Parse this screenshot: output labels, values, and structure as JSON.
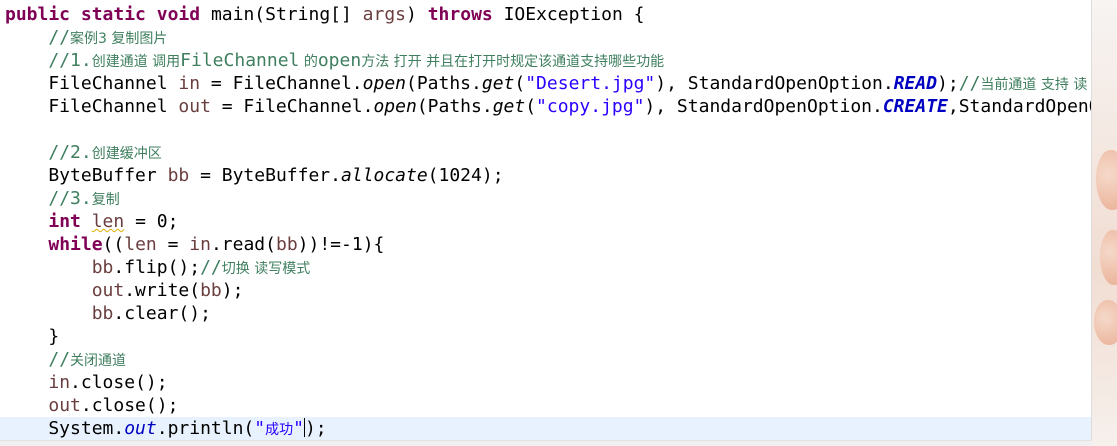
{
  "editor": {
    "language": "Java",
    "lines": [
      [
        {
          "t": "public",
          "c": "kw"
        },
        {
          "t": " "
        },
        {
          "t": "static",
          "c": "kw"
        },
        {
          "t": " "
        },
        {
          "t": "void",
          "c": "kw"
        },
        {
          "t": " main(String[] "
        },
        {
          "t": "args",
          "c": "var"
        },
        {
          "t": ") "
        },
        {
          "t": "throws",
          "c": "kw"
        },
        {
          "t": " IOException {"
        }
      ],
      [
        {
          "t": "    "
        },
        {
          "t": "//",
          "c": "cm"
        },
        {
          "t": "案例3 复制图片",
          "c": "cm cjk"
        }
      ],
      [
        {
          "t": "    "
        },
        {
          "t": "//1.",
          "c": "cm"
        },
        {
          "t": "创建通道 调用",
          "c": "cm cjk"
        },
        {
          "t": "FileChannel",
          "c": "cm"
        },
        {
          "t": " 的",
          "c": "cm cjk"
        },
        {
          "t": "open",
          "c": "cm"
        },
        {
          "t": "方法 打开 并且在打开时规定该通道支持哪些功能",
          "c": "cm cjk"
        }
      ],
      [
        {
          "t": "    FileChannel "
        },
        {
          "t": "in",
          "c": "var"
        },
        {
          "t": " = FileChannel."
        },
        {
          "t": "open",
          "c": "meth"
        },
        {
          "t": "(Paths."
        },
        {
          "t": "get",
          "c": "meth"
        },
        {
          "t": "("
        },
        {
          "t": "\"Desert.jpg\"",
          "c": "str"
        },
        {
          "t": "), StandardOpenOption."
        },
        {
          "t": "READ",
          "c": "const"
        },
        {
          "t": ");"
        },
        {
          "t": "//",
          "c": "cm"
        },
        {
          "t": "当前通道 支持 读",
          "c": "cm cjk"
        }
      ],
      [
        {
          "t": "    FileChannel "
        },
        {
          "t": "out",
          "c": "var"
        },
        {
          "t": " = FileChannel."
        },
        {
          "t": "open",
          "c": "meth"
        },
        {
          "t": "(Paths."
        },
        {
          "t": "get",
          "c": "meth"
        },
        {
          "t": "("
        },
        {
          "t": "\"copy.jpg\"",
          "c": "str"
        },
        {
          "t": "), StandardOpenOption."
        },
        {
          "t": "CREATE",
          "c": "const"
        },
        {
          "t": ",StandardOpenOption"
        }
      ],
      [
        {
          "t": ""
        }
      ],
      [
        {
          "t": "    "
        },
        {
          "t": "//2.",
          "c": "cm"
        },
        {
          "t": "创建缓冲区",
          "c": "cm cjk"
        }
      ],
      [
        {
          "t": "    ByteBuffer "
        },
        {
          "t": "bb",
          "c": "var"
        },
        {
          "t": " = ByteBuffer."
        },
        {
          "t": "allocate",
          "c": "meth"
        },
        {
          "t": "(1024);"
        }
      ],
      [
        {
          "t": "    "
        },
        {
          "t": "//3.",
          "c": "cm"
        },
        {
          "t": "复制",
          "c": "cm cjk"
        }
      ],
      [
        {
          "t": "    "
        },
        {
          "t": "int",
          "c": "kw"
        },
        {
          "t": " "
        },
        {
          "t": "len",
          "c": "var warn"
        },
        {
          "t": " = 0;"
        }
      ],
      [
        {
          "t": "    "
        },
        {
          "t": "while",
          "c": "kw"
        },
        {
          "t": "(("
        },
        {
          "t": "len",
          "c": "var"
        },
        {
          "t": " = "
        },
        {
          "t": "in",
          "c": "var"
        },
        {
          "t": ".read("
        },
        {
          "t": "bb",
          "c": "var"
        },
        {
          "t": "))!=-1){"
        }
      ],
      [
        {
          "t": "        "
        },
        {
          "t": "bb",
          "c": "var"
        },
        {
          "t": ".flip();"
        },
        {
          "t": "//",
          "c": "cm"
        },
        {
          "t": "切换 读写模式",
          "c": "cm cjk"
        }
      ],
      [
        {
          "t": "        "
        },
        {
          "t": "out",
          "c": "var"
        },
        {
          "t": ".write("
        },
        {
          "t": "bb",
          "c": "var"
        },
        {
          "t": ");"
        }
      ],
      [
        {
          "t": "        "
        },
        {
          "t": "bb",
          "c": "var"
        },
        {
          "t": ".clear();"
        }
      ],
      [
        {
          "t": "    }"
        }
      ],
      [
        {
          "t": "    "
        },
        {
          "t": "//",
          "c": "cm"
        },
        {
          "t": "关闭通道",
          "c": "cm cjk"
        }
      ],
      [
        {
          "t": "    "
        },
        {
          "t": "in",
          "c": "var"
        },
        {
          "t": ".close();"
        }
      ],
      [
        {
          "t": "    "
        },
        {
          "t": "out",
          "c": "var"
        },
        {
          "t": ".close();"
        }
      ],
      [
        {
          "t": "    System."
        },
        {
          "t": "out",
          "c": "field"
        },
        {
          "t": ".println("
        },
        {
          "t": "\"",
          "c": "str"
        },
        {
          "t": "成功",
          "c": "str cjk-str"
        },
        {
          "t": "\"",
          "c": "str"
        },
        {
          "t": "|",
          "c": "caret"
        },
        {
          "t": ");"
        }
      ]
    ],
    "current_line_index": 18
  },
  "colors": {
    "keyword": "#7f0055",
    "string": "#2a00ff",
    "comment": "#3f7f5f",
    "field": "#0000c0",
    "local_variable": "#6a3e3e",
    "current_line_highlight": "#e8f2fe"
  }
}
